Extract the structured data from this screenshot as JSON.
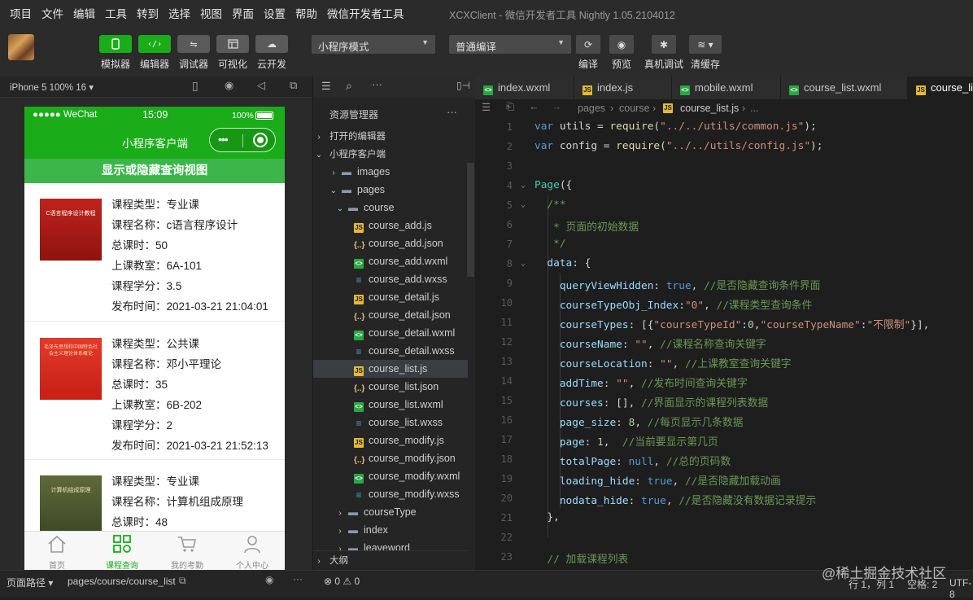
{
  "menubar": {
    "items": [
      "项目",
      "文件",
      "编辑",
      "工具",
      "转到",
      "选择",
      "视图",
      "界面",
      "设置",
      "帮助",
      "微信开发者工具"
    ],
    "window_title": "XCXClient - 微信开发者工具 Nightly 1.05.2104012"
  },
  "toolbar": {
    "buttons": [
      {
        "label": "模拟器",
        "icon": "phone-icon"
      },
      {
        "label": "编辑器",
        "icon": "code-icon"
      },
      {
        "label": "调试器",
        "icon": "debug-icon"
      },
      {
        "label": "可视化",
        "icon": "layout-icon"
      },
      {
        "label": "云开发",
        "icon": "cloud-icon"
      }
    ],
    "mode_select": "小程序模式",
    "compile_select": "普通编译",
    "actions": [
      {
        "label": "编译",
        "icon": "refresh-icon"
      },
      {
        "label": "预览",
        "icon": "eye-icon"
      },
      {
        "label": "真机调试",
        "icon": "bug-icon"
      },
      {
        "label": "清缓存",
        "icon": "layers-icon"
      }
    ]
  },
  "simulator": {
    "device": "iPhone 5 100% 16",
    "status": {
      "carrier": "●●●●● WeChat",
      "time": "15:09",
      "battery": "100%"
    },
    "nav_title": "小程序客户端",
    "toggle_label": "显示或隐藏查询视图",
    "courses": [
      {
        "cover_title": "C语言程序设计教程",
        "lines": [
          "课程类型：专业课",
          "课程名称：c语言程序设计",
          "总课时：50",
          "上课教室：6A-101",
          "课程学分：3.5",
          "发布时间：2021-03-21 21:04:01"
        ]
      },
      {
        "cover_title": "毛泽东思想和中国特色社会主义理论体系概论",
        "lines": [
          "课程类型：公共课",
          "课程名称：邓小平理论",
          "总课时：35",
          "上课教室：6B-202",
          "课程学分：2",
          "发布时间：2021-03-21 21:52:13"
        ]
      },
      {
        "cover_title": "计算机组成原理",
        "lines": [
          "课程类型：专业课",
          "课程名称：计算机组成原理",
          "总课时：48"
        ]
      }
    ],
    "tabs": [
      {
        "label": "首页",
        "icon": "home-icon"
      },
      {
        "label": "课程查询",
        "icon": "grid-icon"
      },
      {
        "label": "我的考勤",
        "icon": "cart-icon"
      },
      {
        "label": "个人中心",
        "icon": "user-icon"
      }
    ],
    "accent": "#1aad19"
  },
  "explorer": {
    "title": "资源管理器",
    "sections": {
      "open_editors": "打开的编辑器",
      "project": "小程序客户端",
      "outline": "大纲"
    },
    "tree": [
      {
        "name": "images",
        "type": "folder",
        "depth": 1
      },
      {
        "name": "pages",
        "type": "folder",
        "depth": 1
      },
      {
        "name": "course",
        "type": "folder",
        "depth": 2
      },
      {
        "name": "course_add.js",
        "type": "js",
        "depth": 3
      },
      {
        "name": "course_add.json",
        "type": "json",
        "depth": 3
      },
      {
        "name": "course_add.wxml",
        "type": "wxml",
        "depth": 3
      },
      {
        "name": "course_add.wxss",
        "type": "wxss",
        "depth": 3
      },
      {
        "name": "course_detail.js",
        "type": "js",
        "depth": 3
      },
      {
        "name": "course_detail.json",
        "type": "json",
        "depth": 3
      },
      {
        "name": "course_detail.wxml",
        "type": "wxml",
        "depth": 3
      },
      {
        "name": "course_detail.wxss",
        "type": "wxss",
        "depth": 3
      },
      {
        "name": "course_list.js",
        "type": "js",
        "depth": 3
      },
      {
        "name": "course_list.json",
        "type": "json",
        "depth": 3
      },
      {
        "name": "course_list.wxml",
        "type": "wxml",
        "depth": 3
      },
      {
        "name": "course_list.wxss",
        "type": "wxss",
        "depth": 3
      },
      {
        "name": "course_modify.js",
        "type": "js",
        "depth": 3
      },
      {
        "name": "course_modify.json",
        "type": "json",
        "depth": 3
      },
      {
        "name": "course_modify.wxml",
        "type": "wxml",
        "depth": 3
      },
      {
        "name": "course_modify.wxss",
        "type": "wxss",
        "depth": 3
      },
      {
        "name": "courseType",
        "type": "folder",
        "depth": 2
      },
      {
        "name": "index",
        "type": "folder",
        "depth": 2
      },
      {
        "name": "leaveword",
        "type": "folder",
        "depth": 2
      }
    ],
    "selected": "course_list.js"
  },
  "editor": {
    "tabs": [
      {
        "name": "index.wxml",
        "type": "wxml"
      },
      {
        "name": "index.js",
        "type": "js"
      },
      {
        "name": "mobile.wxml",
        "type": "wxml"
      },
      {
        "name": "course_list.wxml",
        "type": "wxml"
      },
      {
        "name": "course_li",
        "type": "js"
      }
    ],
    "breadcrumb": [
      "pages",
      "course",
      "course_list.js",
      "..."
    ],
    "line_numbers": [
      "1",
      "2",
      "3",
      "4",
      "5",
      "6",
      "7",
      "8",
      "9",
      "10",
      "11",
      "12",
      "13",
      "14",
      "15",
      "16",
      "17",
      "18",
      "19",
      "20",
      "21",
      "22",
      "23"
    ]
  },
  "statusbar": {
    "left_label": "页面路径",
    "path": "pages/course/course_list",
    "problems": "0",
    "warnings": "0",
    "position": "行 1，列 1",
    "indent": "空格: 2",
    "encoding": "UTF-8",
    "watermark": "@稀土掘金技术社区"
  }
}
